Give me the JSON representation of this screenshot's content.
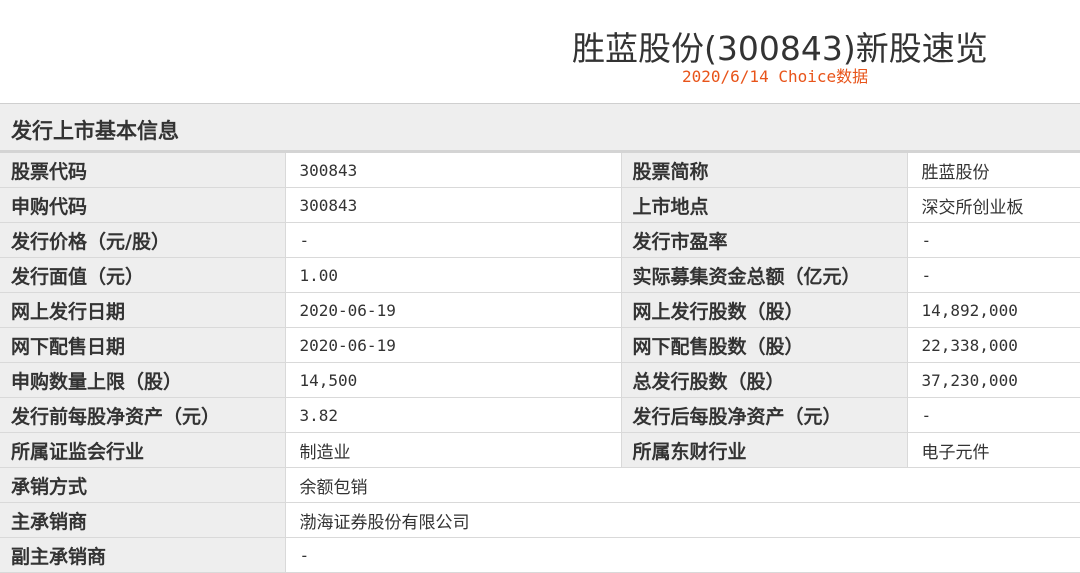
{
  "header": {
    "title": "胜蓝股份(300843)新股速览",
    "subtitle": "2020/6/14  Choice数据"
  },
  "section": {
    "title": "发行上市基本信息"
  },
  "rows": [
    {
      "label1": "股票代码",
      "value1": "300843",
      "label2": "股票简称",
      "value2": "胜蓝股份"
    },
    {
      "label1": "申购代码",
      "value1": "300843",
      "label2": "上市地点",
      "value2": "深交所创业板"
    },
    {
      "label1": "发行价格（元/股）",
      "value1": "-",
      "label2": "发行市盈率",
      "value2": "-"
    },
    {
      "label1": "发行面值（元）",
      "value1": "1.00",
      "label2": "实际募集资金总额（亿元）",
      "value2": "-"
    },
    {
      "label1": "网上发行日期",
      "value1": "2020-06-19",
      "label2": "网上发行股数（股）",
      "value2": "14,892,000"
    },
    {
      "label1": "网下配售日期",
      "value1": "2020-06-19",
      "label2": "网下配售股数（股）",
      "value2": "22,338,000"
    },
    {
      "label1": "申购数量上限（股）",
      "value1": "14,500",
      "label2": "总发行股数（股）",
      "value2": "37,230,000"
    },
    {
      "label1": "发行前每股净资产（元）",
      "value1": "3.82",
      "label2": "发行后每股净资产（元）",
      "value2": "-"
    },
    {
      "label1": "所属证监会行业",
      "value1": "制造业",
      "label2": "所属东财行业",
      "value2": "电子元件"
    }
  ],
  "full_rows": [
    {
      "label": "承销方式",
      "value": "余额包销"
    },
    {
      "label": "主承销商",
      "value": "渤海证券股份有限公司"
    },
    {
      "label": "副主承销商",
      "value": "-"
    }
  ]
}
